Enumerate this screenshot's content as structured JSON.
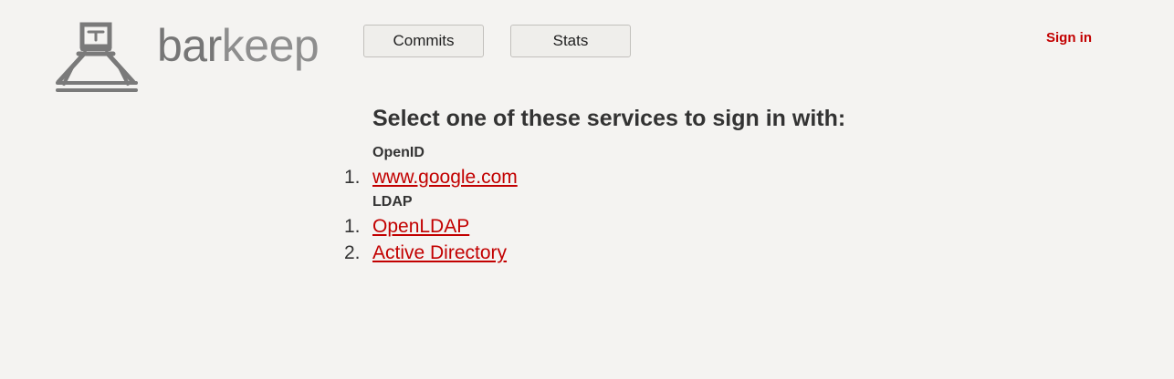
{
  "brand": {
    "name_part1": "bar",
    "name_part2": "keep"
  },
  "nav": {
    "commits_label": "Commits",
    "stats_label": "Stats"
  },
  "header": {
    "signin_label": "Sign in"
  },
  "main": {
    "heading": "Select one of these services to sign in with:",
    "groups": [
      {
        "title": "OpenID",
        "items": [
          {
            "num": "1.",
            "label": "www.google.com"
          }
        ]
      },
      {
        "title": "LDAP",
        "items": [
          {
            "num": "1.",
            "label": "OpenLDAP"
          },
          {
            "num": "2.",
            "label": "Active Directory"
          }
        ]
      }
    ]
  },
  "colors": {
    "link": "#c20000",
    "background": "#f4f3f1",
    "logo": "#7a7a7a"
  },
  "icons": {
    "logo": "barkeep-tap-icon"
  }
}
